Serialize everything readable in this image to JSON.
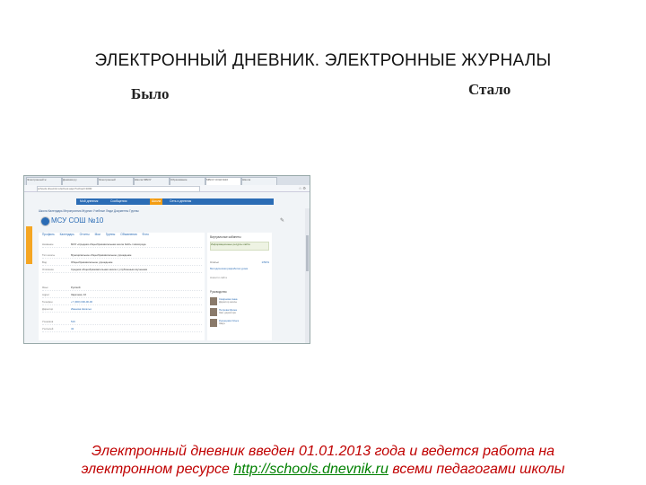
{
  "slide": {
    "title": "ЭЛЕКТРОННЫЙ ДНЕВНИК. ЭЛЕКТРОННЫЕ ЖУРНАЛЫ",
    "before_label": "Было",
    "after_label": "Стало",
    "footer_line1": "Электронный дневник введен 01.01.2013 года и ведется работа на",
    "footer_line2_prefix": "электронном ресурсе ",
    "footer_link": "http://schools.dnevnik.ru",
    "footer_line2_suffix": " всеми педагогами школы"
  },
  "screenshot": {
    "browser_tabs": [
      "Электронный ж",
      "Дневник.ру",
      "Электронный",
      "Школа МБОУ",
      "Образование",
      "МБОУ СОШ №10",
      "Школа"
    ],
    "address": "schools.dnevnik.ru/school.aspx?school=1000",
    "nav_items": [
      "Мой дневник",
      "Сообщения",
      "Школа",
      "Сеть и дневник"
    ],
    "school_links": "Школа  Календарь  Мероприятия  Журнал  Учебные  Люди  Документы  Группы",
    "school_name": "МСУ СОШ №10",
    "content_tabs": [
      "Профиль",
      "Календарь",
      "Отчеты",
      "Мои",
      "Группы",
      "Объявления",
      "Фото"
    ],
    "rows": [
      {
        "k": "Название",
        "v": "МОУ «Средняя общеобразовательная школа №10» г.Новгорода"
      },
      {
        "k": "Тип школы",
        "v": "Муниципальное общеобразовательное учреждение"
      },
      {
        "k": "Вид",
        "v": "Общеобразовательное учреждение"
      },
      {
        "k": "Описание",
        "v": "Средняя общеобразовательная школа с углубленным изучением"
      },
      {
        "k": "Язык",
        "v": "Русский"
      },
      {
        "k": "Адрес",
        "v": "Заречная, 10"
      },
      {
        "k": "Телефон",
        "v": "+7 (000) 000-00-00"
      },
      {
        "k": "Директор",
        "v": "Иванова Наталья"
      },
      {
        "k": "Учеников",
        "v": "519"
      },
      {
        "k": "Учителей",
        "v": "43"
      }
    ],
    "sidebar": {
      "title": "Виртуальные кабинеты",
      "card1": "Информационные ресурсы сайта",
      "stat_label": "Статьи",
      "stat_value": "1/50%",
      "card2": "Методическая разработка урока",
      "card2_sub": "Новости сайта",
      "people_title": "Руководство",
      "people": [
        {
          "name": "Смирнова Анна",
          "role": "Директор школы"
        },
        {
          "name": "Петрова Ирина",
          "role": "Зам. директора"
        },
        {
          "name": "Кузнецова Ольга",
          "role": "Завуч"
        }
      ]
    }
  }
}
